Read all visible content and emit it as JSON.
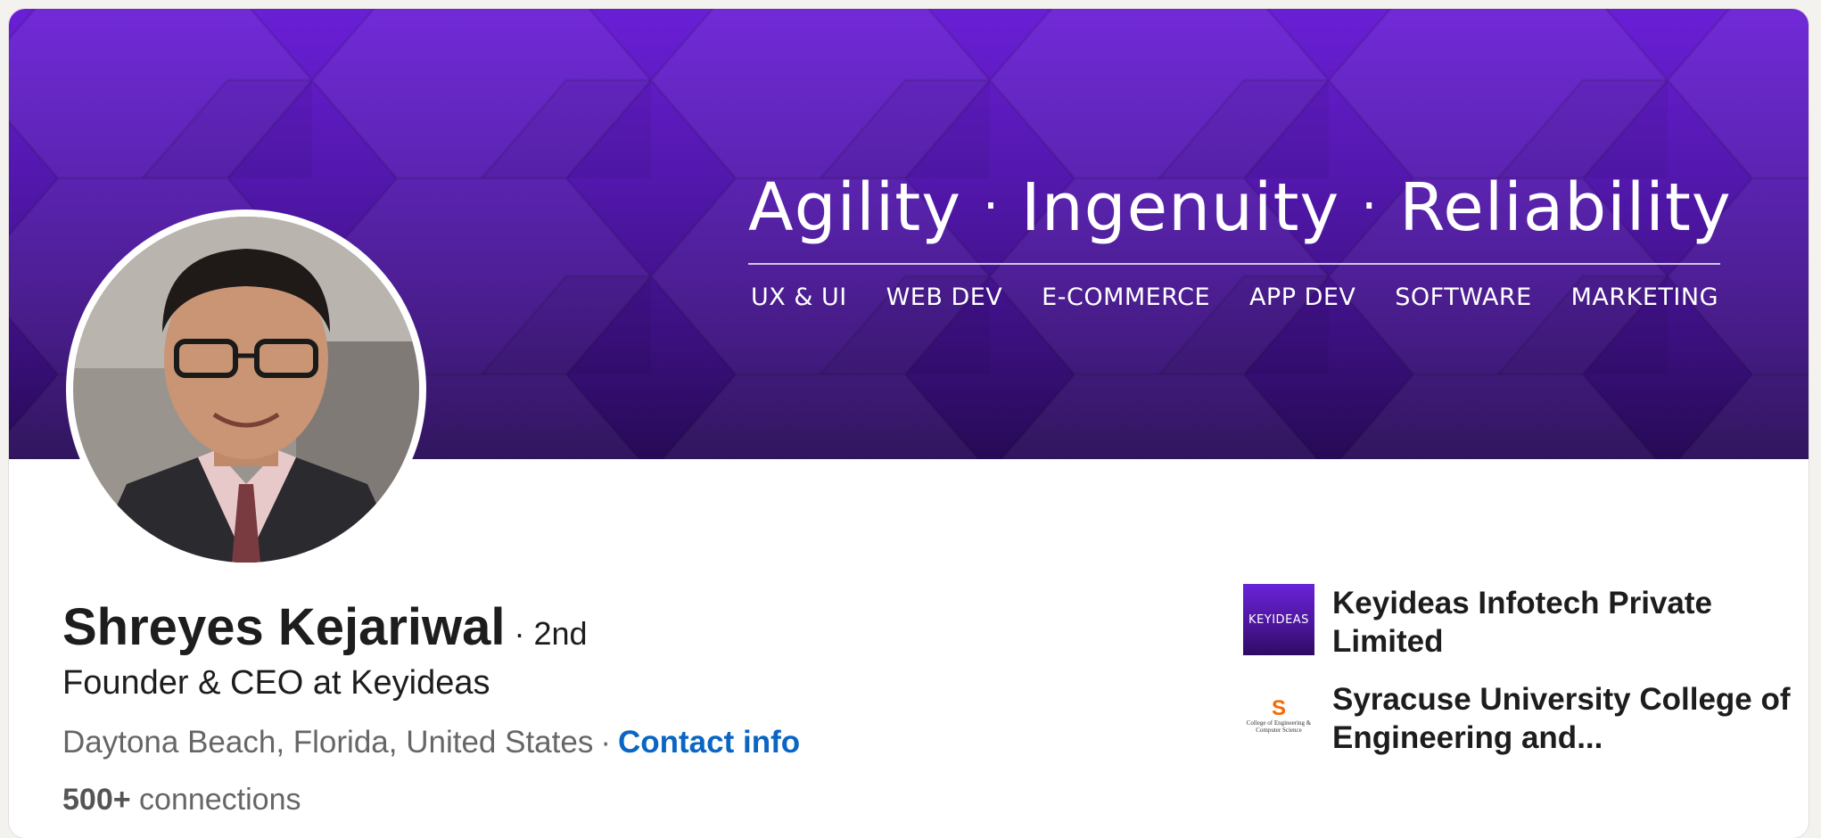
{
  "banner": {
    "tagline_words": [
      "Agility",
      "Ingenuity",
      "Reliability"
    ],
    "separator": "·",
    "services": [
      "UX & UI",
      "WEB DEV",
      "E-COMMERCE",
      "APP DEV",
      "SOFTWARE",
      "MARKETING"
    ],
    "colors": {
      "top": "#6a1fd6",
      "bottom": "#260a55"
    }
  },
  "profile": {
    "name": "Shreyes Kejariwal",
    "degree": "· 2nd",
    "headline": "Founder & CEO at Keyideas",
    "location": "Daytona Beach, Florida, United States",
    "location_separator": "·",
    "contact_label": "Contact info",
    "connections_count": "500+",
    "connections_label": "connections"
  },
  "affiliations": [
    {
      "name": "Keyideas Infotech Private Limited",
      "logo_text": "KEYIDEAS",
      "icon": "keyideas-logo"
    },
    {
      "name": "Syracuse University College of Engineering and...",
      "logo_mark": "S",
      "logo_text": "College of Engineering & Computer Science",
      "icon": "syracuse-logo"
    }
  ],
  "colors": {
    "link": "#0a66c2",
    "text_primary": "#1d1d1d",
    "text_secondary": "#666666"
  }
}
